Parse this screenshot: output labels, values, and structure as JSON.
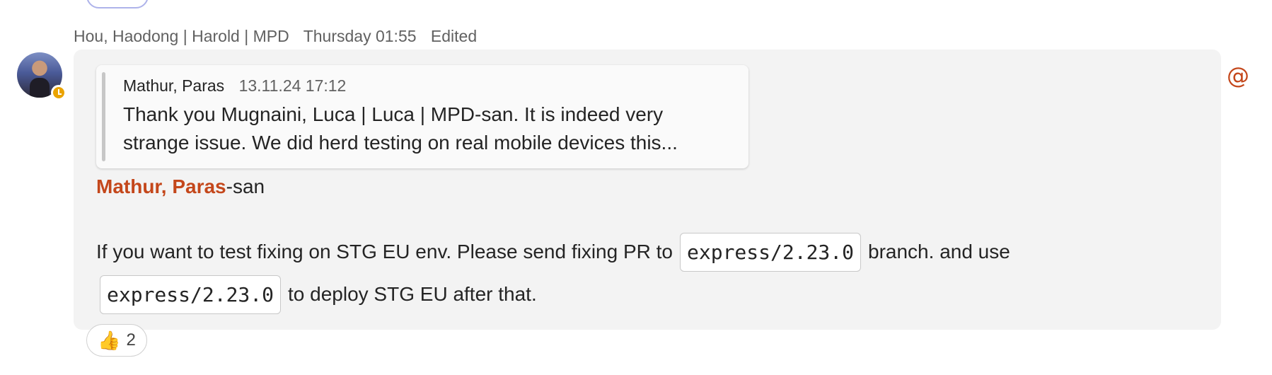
{
  "message": {
    "author": "Hou, Haodong | Harold | MPD",
    "timestamp": "Thursday 01:55",
    "edited_label": "Edited",
    "presence_status": "away",
    "quote": {
      "author": "Mathur, Paras",
      "timestamp": "13.11.24 17:12",
      "text": "Thank you Mugnaini, Luca | Luca | MPD-san. It is indeed very strange issue. We did herd testing on real mobile devices this..."
    },
    "mention": {
      "name": "Mathur, Paras",
      "suffix": "-san"
    },
    "body": {
      "line1_text": "If you want to test fixing on STG EU env. Please send fixing PR to",
      "code1": "express/2.23.0",
      "line1_tail": "branch. and use",
      "code2": "express/2.23.0",
      "line2_text": "to deploy STG EU after that."
    },
    "reaction": {
      "emoji": "👍",
      "count": "2"
    },
    "mention_indicator": "@"
  },
  "colors": {
    "mention": "#c4471b",
    "bubble_bg": "#f3f3f3",
    "presence_away": "#eaa300"
  }
}
